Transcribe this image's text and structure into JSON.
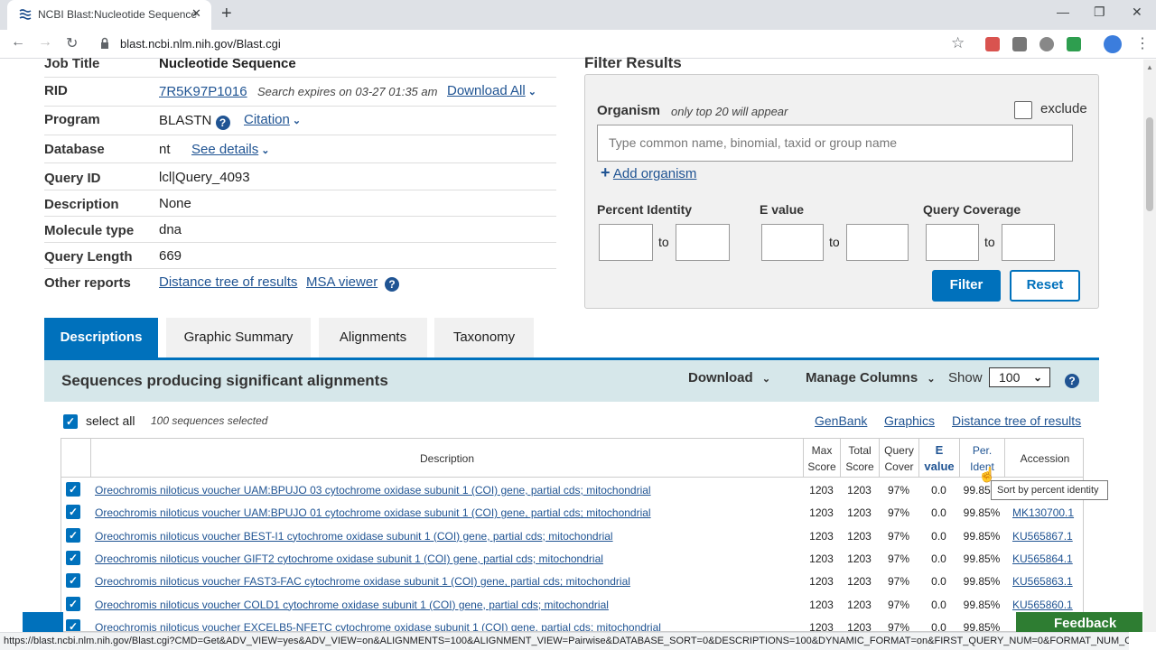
{
  "browser": {
    "tab_title": "NCBI Blast:Nucleotide Sequence",
    "url": "blast.ncbi.nlm.nih.gov/Blast.cgi",
    "status_url": "https://blast.ncbi.nlm.nih.gov/Blast.cgi?CMD=Get&ADV_VIEW=yes&ADV_VIEW=on&ALIGNMENTS=100&ALIGNMENT_VIEW=Pairwise&DATABASE_SORT=0&DESCRIPTIONS=100&DYNAMIC_FORMAT=on&FIRST_QUERY_NUM=0&FORMAT_NUM_OR..."
  },
  "job": {
    "job_title_label": "Job Title",
    "job_title": "Nucleotide Sequence",
    "rid_label": "RID",
    "rid": "7R5K97P1016",
    "expires": "Search expires on 03-27 01:35 am",
    "download_all": "Download All",
    "program_label": "Program",
    "program": "BLASTN",
    "citation": "Citation",
    "database_label": "Database",
    "database": "nt",
    "see_details": "See details",
    "query_id_label": "Query ID",
    "query_id": "lcl|Query_4093",
    "description_label": "Description",
    "description": "None",
    "molecule_label": "Molecule type",
    "molecule": "dna",
    "length_label": "Query Length",
    "length": "669",
    "other_label": "Other reports",
    "distance_tree": "Distance tree of results",
    "msa_viewer": "MSA viewer"
  },
  "filter": {
    "title": "Filter Results",
    "organism_label": "Organism",
    "organism_hint": "only top 20 will appear",
    "exclude": "exclude",
    "organism_placeholder": "Type common  name, binomial, taxid or group  name",
    "add_organism": "Add organism",
    "percent_identity": "Percent Identity",
    "e_value": "E value",
    "query_coverage": "Query Coverage",
    "to": "to",
    "filter_btn": "Filter",
    "reset_btn": "Reset"
  },
  "tabs": [
    "Descriptions",
    "Graphic Summary",
    "Alignments",
    "Taxonomy"
  ],
  "results": {
    "title": "Sequences producing significant alignments",
    "download": "Download",
    "manage_columns": "Manage Columns",
    "show": "Show",
    "show_value": "100",
    "select_all": "select all",
    "selected": "100 sequences selected",
    "genbank": "GenBank",
    "graphics": "Graphics",
    "distance_tree": "Distance tree of results"
  },
  "table": {
    "headers": {
      "description": "Description",
      "max_score": "Max Score",
      "total_score": "Total Score",
      "query_cover": "Query Cover",
      "e_value": "E value",
      "per_ident": "Per. Ident",
      "accession": "Accession"
    },
    "rows": [
      {
        "desc": "Oreochromis niloticus voucher UAM:BPUJO 03 cytochrome oxidase subunit 1 (COI) gene, partial cds; mitochondrial",
        "max": "1203",
        "total": "1203",
        "cover": "97%",
        "e": "0.0",
        "ident": "99.85%",
        "acc": ""
      },
      {
        "desc": "Oreochromis niloticus voucher UAM:BPUJO 01 cytochrome oxidase subunit 1 (COI) gene, partial cds; mitochondrial",
        "max": "1203",
        "total": "1203",
        "cover": "97%",
        "e": "0.0",
        "ident": "99.85%",
        "acc": "MK130700.1"
      },
      {
        "desc": "Oreochromis niloticus voucher BEST-I1 cytochrome oxidase subunit 1 (COI) gene, partial cds; mitochondrial",
        "max": "1203",
        "total": "1203",
        "cover": "97%",
        "e": "0.0",
        "ident": "99.85%",
        "acc": "KU565867.1"
      },
      {
        "desc": "Oreochromis niloticus voucher GIFT2 cytochrome oxidase subunit 1 (COI) gene, partial cds; mitochondrial",
        "max": "1203",
        "total": "1203",
        "cover": "97%",
        "e": "0.0",
        "ident": "99.85%",
        "acc": "KU565864.1"
      },
      {
        "desc": "Oreochromis niloticus voucher FAST3-FAC cytochrome oxidase subunit 1 (COI) gene, partial cds; mitochondrial",
        "max": "1203",
        "total": "1203",
        "cover": "97%",
        "e": "0.0",
        "ident": "99.85%",
        "acc": "KU565863.1"
      },
      {
        "desc": "Oreochromis niloticus voucher COLD1 cytochrome oxidase subunit 1 (COI) gene, partial cds; mitochondrial",
        "max": "1203",
        "total": "1203",
        "cover": "97%",
        "e": "0.0",
        "ident": "99.85%",
        "acc": "KU565860.1"
      },
      {
        "desc": "Oreochromis niloticus voucher EXCELB5-NFETC cytochrome oxidase subunit 1 (COI) gene, partial cds; mitochondrial",
        "max": "1203",
        "total": "1203",
        "cover": "97%",
        "e": "0.0",
        "ident": "99.85%",
        "acc": ""
      }
    ]
  },
  "tooltip": "Sort by percent identity",
  "feedback": "Feedback",
  "colors": {
    "primary": "#0071bc",
    "link": "#205493",
    "header_band": "#d6e7ea"
  }
}
